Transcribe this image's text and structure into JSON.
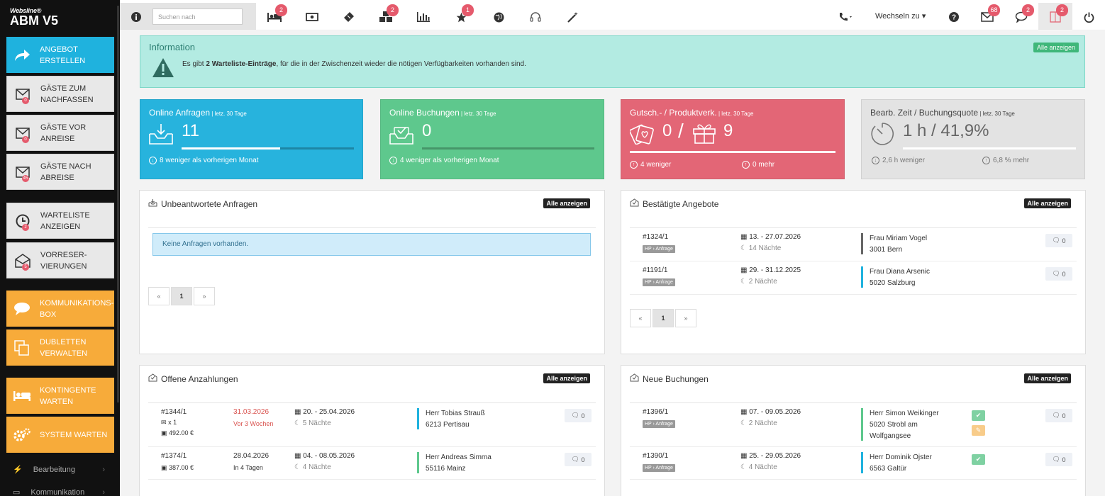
{
  "app": {
    "brand_small": "Websline®",
    "brand_large": "ABM V5"
  },
  "sidebar": {
    "items": [
      {
        "label": "ANGEBOT ERSTELLEN",
        "icon": "share-arrow-icon"
      },
      {
        "label": "GÄSTE ZUM NACHFASSEN",
        "badge": "0",
        "icon": "envelope-icon"
      },
      {
        "label": "GÄSTE VOR ANREISE",
        "badge": "0",
        "icon": "envelope-icon"
      },
      {
        "label": "GÄSTE NACH ABREISE",
        "badge": "45",
        "icon": "envelope-icon"
      },
      {
        "label": "WARTELISTE ANZEIGEN",
        "badge": "2",
        "icon": "clock-icon"
      },
      {
        "label": "VORRESER-VIERUNGEN",
        "badge": "5",
        "icon": "open-envelope-icon"
      },
      {
        "label": "KOMMUNIKATIONS-BOX",
        "icon": "speech-bubble-icon"
      },
      {
        "label": "DUBLETTEN VERWALTEN",
        "icon": "copy-icon"
      },
      {
        "label": "KONTINGENTE WARTEN",
        "icon": "bed-icon"
      },
      {
        "label": "SYSTEM WARTEN",
        "icon": "gears-icon"
      }
    ],
    "links": [
      {
        "label": "Bearbeitung",
        "icon": "bolt-icon"
      },
      {
        "label": "Kommunikation",
        "icon": "window-icon"
      }
    ]
  },
  "topbar": {
    "search_placeholder": "Suchen nach",
    "icon_badges": {
      "bed": "2",
      "cubes": "2",
      "star": "1"
    },
    "switch_label": "Wechseln zu",
    "mail_badge": "68",
    "chat_badge": "2",
    "panel_badge": "2"
  },
  "info": {
    "title": "Information",
    "show_all": "Alle anzeigen",
    "msg_pre": "Es gibt ",
    "msg_bold": "2 Warteliste-Einträge",
    "msg_post": ", für die in der Zwischenzeit wieder die nötigen Verfügbarkeiten vorhanden sind."
  },
  "stats": [
    {
      "title": "Online Anfragen",
      "period": " | letz. 30 Tage",
      "value": "11",
      "progress": 0.57,
      "foot": "8 weniger als vorherigen Monat"
    },
    {
      "title": "Online Buchungen",
      "period": " | letz. 30 Tage",
      "value": "0",
      "progress": 0,
      "foot": "4 weniger als vorherigen Monat"
    },
    {
      "title": "Gutsch.- / Produktverk.",
      "period": " | letz. 30 Tage",
      "value_a": "0",
      "slash": "/",
      "value_b": "9",
      "progress": 1,
      "foot_a": "4 weniger",
      "foot_b": "0 mehr"
    },
    {
      "title": "Bearb. Zeit / Buchungsquote",
      "period": " | letz. 30 Tage",
      "value": "1 h / 41,9%",
      "progress": 1,
      "foot_a": "2,6 h weniger",
      "foot_b": "6,8 % mehr"
    }
  ],
  "panels": {
    "unanswered": {
      "title": "Unbeantwortete Anfragen",
      "button": "Alle anzeigen",
      "empty": "Keine Anfragen vorhanden."
    },
    "confirmed": {
      "title": "Bestätigte Angebote",
      "button": "Alle anzeigen",
      "rows": [
        {
          "id": "#1324/1",
          "tag": "HP › Anfrage",
          "dates": "13. - 27.07.2026",
          "nights": "14 Nächte",
          "name": "Frau Miriam Vogel",
          "city": "3001 Bern",
          "comments": "0",
          "color": "#666666"
        },
        {
          "id": "#1191/1",
          "tag": "HP › Anfrage",
          "dates": "29. - 31.12.2025",
          "nights": "2 Nächte",
          "name": "Frau Diana Arsenic",
          "city": "5020 Salzburg",
          "comments": "0",
          "color": "#1fb2de"
        }
      ]
    },
    "deposits": {
      "title": "Offene Anzahlungen",
      "button": "Alle anzeigen",
      "rows": [
        {
          "id": "#1344/1",
          "mail": "x 1",
          "amount": "492.00 €",
          "due": "31.03.2026",
          "due_note": "Vor 3 Wochen",
          "dates": "20. - 25.04.2026",
          "nights": "5 Nächte",
          "name": "Herr Tobias Strauß",
          "city": "6213 Pertisau",
          "comments": "0",
          "color": "#1fb2de"
        },
        {
          "id": "#1374/1",
          "amount": "387.00 €",
          "due": "28.04.2026",
          "due_note": "In 4 Tagen",
          "dates": "04. - 08.05.2026",
          "nights": "4 Nächte",
          "name": "Herr Andreas Simma",
          "city": "55116 Mainz",
          "comments": "0",
          "color": "#5ec88d"
        }
      ]
    },
    "new_bookings": {
      "title": "Neue Buchungen",
      "button": "Alle anzeigen",
      "rows": [
        {
          "id": "#1396/1",
          "tag": "HP › Anfrage",
          "dates": "07. - 09.05.2026",
          "nights": "2 Nächte",
          "name": "Herr Simon Weikinger",
          "city": "5020 Strobl am",
          "city2": "Wolfgangsee",
          "comments": "0",
          "color": "#5ec88d"
        },
        {
          "id": "#1390/1",
          "tag": "HP › Anfrage",
          "dates": "25. - 29.05.2026",
          "nights": "4 Nächte",
          "name": "Herr Dominik Ojster",
          "city": "6563 Galtür",
          "comments": "0",
          "color": "#1fb2de"
        }
      ]
    }
  },
  "pager": {
    "prev": "«",
    "current": "1",
    "next": "»"
  },
  "colors": {
    "blue": "#27b3dd",
    "green": "#5ec88d",
    "red": "#e36676",
    "orange": "#f7ab3a",
    "teal_info": "#b3ebe2"
  }
}
